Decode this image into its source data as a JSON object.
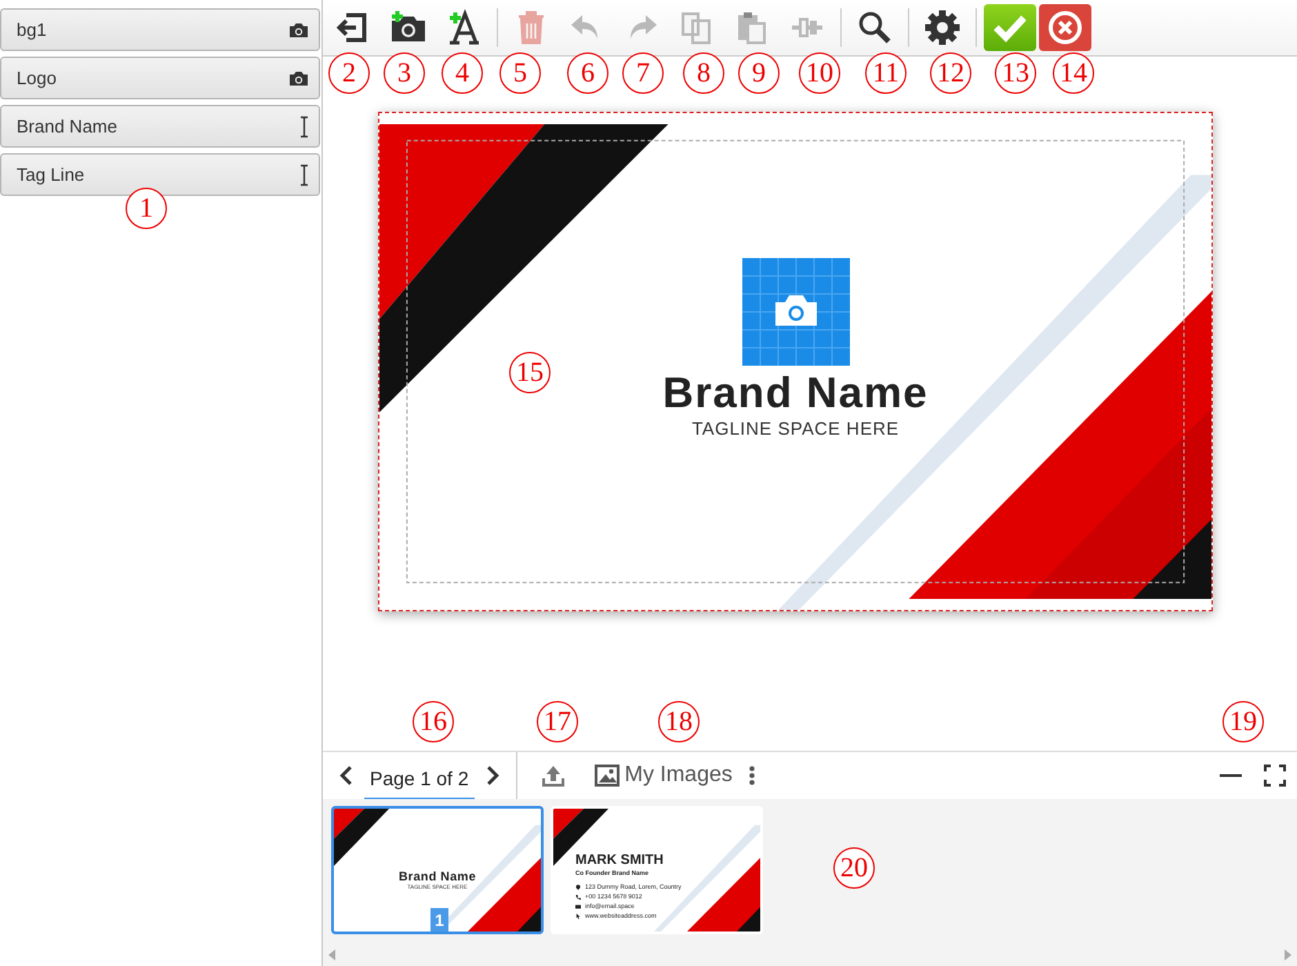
{
  "layers": [
    {
      "name": "bg1",
      "kind": "image"
    },
    {
      "name": "Logo",
      "kind": "image"
    },
    {
      "name": "Brand Name",
      "kind": "text"
    },
    {
      "name": "Tag Line",
      "kind": "text"
    }
  ],
  "toolbar": [
    {
      "kind": "exit",
      "disabled": false
    },
    {
      "kind": "add-image",
      "disabled": false
    },
    {
      "kind": "add-text",
      "disabled": false
    },
    {
      "kind": "separator"
    },
    {
      "kind": "delete",
      "disabled": true
    },
    {
      "kind": "undo",
      "disabled": true
    },
    {
      "kind": "redo",
      "disabled": true
    },
    {
      "kind": "copy",
      "disabled": true
    },
    {
      "kind": "paste",
      "disabled": true
    },
    {
      "kind": "align",
      "disabled": true
    },
    {
      "kind": "separator"
    },
    {
      "kind": "zoom",
      "disabled": false
    },
    {
      "kind": "separator"
    },
    {
      "kind": "settings",
      "disabled": false
    },
    {
      "kind": "separator"
    },
    {
      "kind": "confirm"
    },
    {
      "kind": "cancel"
    }
  ],
  "canvas": {
    "brand_name": "Brand Name",
    "tagline": "TAGLINE SPACE HERE"
  },
  "pager": {
    "label": "Page 1 of 2"
  },
  "my_images": {
    "label": "My Images"
  },
  "thumbnails": [
    {
      "kind": "logo",
      "selected": true,
      "brand_name": "Brand Name",
      "tagline": "TAGLINE SPACE HERE",
      "badge": "1"
    },
    {
      "kind": "contact",
      "selected": false,
      "name": "MARK SMITH",
      "title": "Co Founder Brand Name",
      "lines": [
        {
          "kind": "pin",
          "text": "123 Dummy Road, Lorem, Country"
        },
        {
          "kind": "phone",
          "text": "+00 1234 5678 9012"
        },
        {
          "kind": "mail",
          "text": "info@email.space"
        },
        {
          "kind": "cursor",
          "text": "www.websiteaddress.com"
        }
      ]
    }
  ],
  "callouts": [
    {
      "label": "1"
    },
    {
      "label": "2"
    },
    {
      "label": "3"
    },
    {
      "label": "4"
    },
    {
      "label": "5"
    },
    {
      "label": "6"
    },
    {
      "label": "7"
    },
    {
      "label": "8"
    },
    {
      "label": "9"
    },
    {
      "label": "10"
    },
    {
      "label": "11"
    },
    {
      "label": "12"
    },
    {
      "label": "13"
    },
    {
      "label": "14"
    },
    {
      "label": "15"
    },
    {
      "label": "16"
    },
    {
      "label": "17"
    },
    {
      "label": "18"
    },
    {
      "label": "19"
    },
    {
      "label": "20"
    }
  ]
}
